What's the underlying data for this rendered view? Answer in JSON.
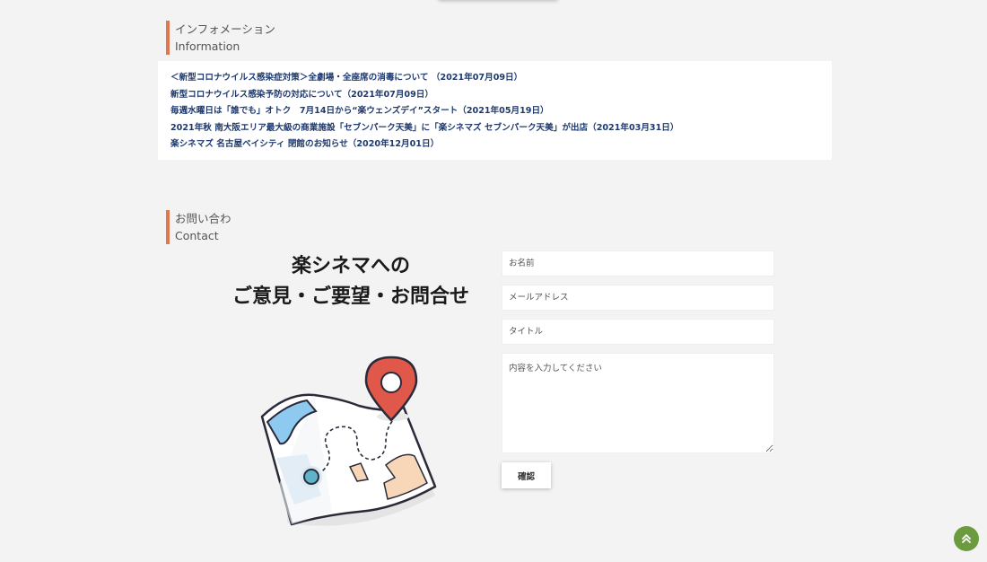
{
  "info_section": {
    "heading_jp": "インフォメーション",
    "heading_en": "Information",
    "news": [
      "＜新型コロナウイルス感染症対策＞全劇場・全座席の消毒について （2021年07月09日）",
      "新型コロナウイルス感染予防の対応について（2021年07月09日）",
      "毎週水曜日は「誰でも」オトク　7月14日から“楽ウェンズデイ”スタート（2021年05月19日）",
      "2021年秋 南大阪エリア最大級の商業施設「セブンパーク天美」に「楽シネマズ セブンパーク天美」が出店（2021年03月31日）",
      "楽シネマズ 名古屋ベイシティ 閉館のお知らせ（2020年12月01日）"
    ]
  },
  "contact_section": {
    "heading_jp": "お問い合わ",
    "heading_en": "Contact",
    "title_line1": "楽シネマへの",
    "title_line2": "ご意見・ご要望・お問合せ",
    "form": {
      "name_placeholder": "お名前",
      "email_placeholder": "メールアドレス",
      "title_placeholder": "タイトル",
      "message_placeholder": "内容を入力してください",
      "submit_label": "確認"
    }
  },
  "icons": {
    "illustration": "map-pin-illustration",
    "back_to_top": "double-chevron-up-icon"
  },
  "colors": {
    "accent": "#e0784f",
    "link": "#1f3a6e",
    "back_to_top": "#6c9a3e",
    "pin": "#e0584a"
  }
}
